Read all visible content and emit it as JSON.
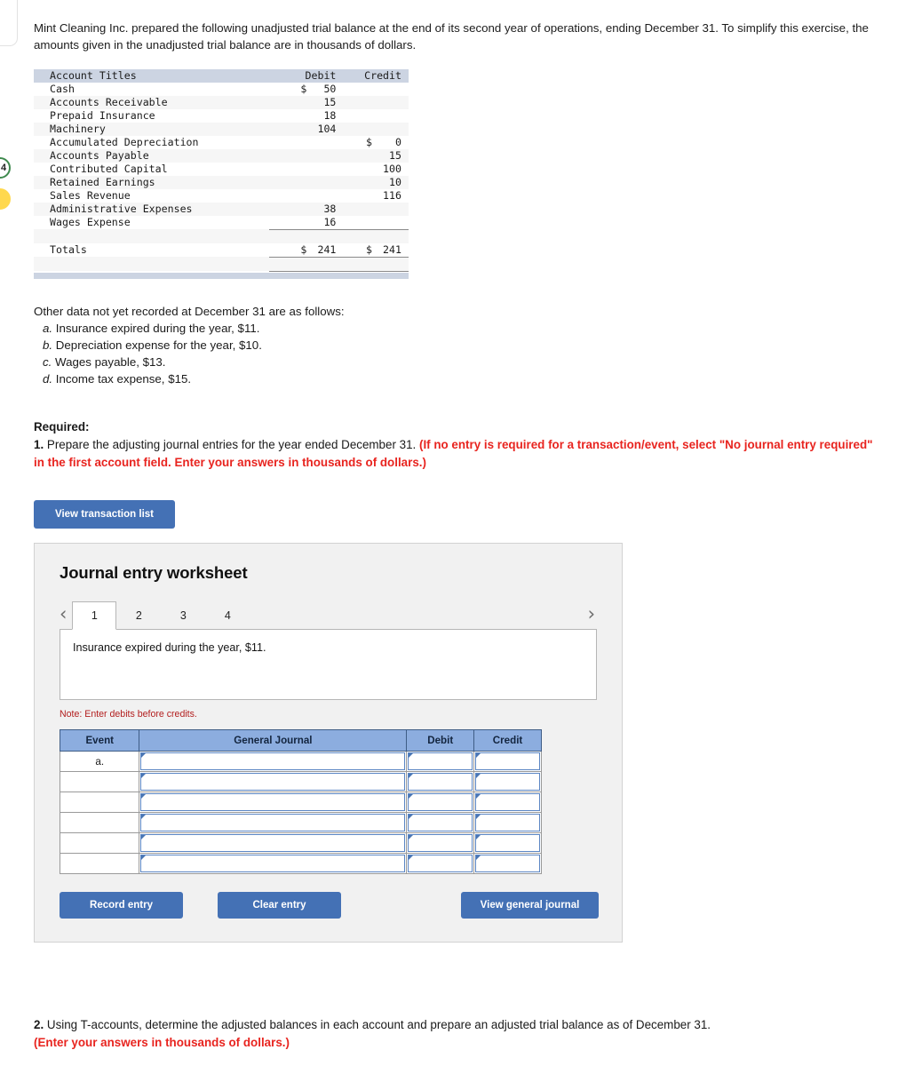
{
  "intro": {
    "paragraph": "Mint Cleaning Inc. prepared the following unadjusted trial balance at the end of its second year of operations, ending December 31. To simplify this exercise, the amounts given in the unadjusted trial balance are in thousands of dollars."
  },
  "trial_balance": {
    "headers": {
      "account": "Account Titles",
      "debit": "Debit",
      "credit": "Credit"
    },
    "rows": [
      {
        "account": "Cash",
        "debit_sym": "$",
        "debit": "50",
        "credit_sym": "",
        "credit": ""
      },
      {
        "account": "Accounts Receivable",
        "debit_sym": "",
        "debit": "15",
        "credit_sym": "",
        "credit": ""
      },
      {
        "account": "Prepaid Insurance",
        "debit_sym": "",
        "debit": "18",
        "credit_sym": "",
        "credit": ""
      },
      {
        "account": "Machinery",
        "debit_sym": "",
        "debit": "104",
        "credit_sym": "",
        "credit": ""
      },
      {
        "account": "Accumulated Depreciation",
        "debit_sym": "",
        "debit": "",
        "credit_sym": "$",
        "credit": "0"
      },
      {
        "account": "Accounts Payable",
        "debit_sym": "",
        "debit": "",
        "credit_sym": "",
        "credit": "15"
      },
      {
        "account": "Contributed Capital",
        "debit_sym": "",
        "debit": "",
        "credit_sym": "",
        "credit": "100"
      },
      {
        "account": "Retained Earnings",
        "debit_sym": "",
        "debit": "",
        "credit_sym": "",
        "credit": "10"
      },
      {
        "account": "Sales Revenue",
        "debit_sym": "",
        "debit": "",
        "credit_sym": "",
        "credit": "116"
      },
      {
        "account": "Administrative Expenses",
        "debit_sym": "",
        "debit": "38",
        "credit_sym": "",
        "credit": ""
      },
      {
        "account": "Wages Expense",
        "debit_sym": "",
        "debit": "16",
        "credit_sym": "",
        "credit": ""
      }
    ],
    "totals": {
      "label": "Totals",
      "debit_sym": "$",
      "debit": "241",
      "credit_sym": "$",
      "credit": "241"
    }
  },
  "other_data": {
    "lead": "Other data not yet recorded at December 31 are as follows:",
    "items": [
      {
        "letter": "a.",
        "text": "Insurance expired during the year, $11."
      },
      {
        "letter": "b.",
        "text": "Depreciation expense for the year, $10."
      },
      {
        "letter": "c.",
        "text": "Wages payable, $13."
      },
      {
        "letter": "d.",
        "text": "Income tax expense, $15."
      }
    ]
  },
  "required": {
    "heading": "Required:",
    "number": "1.",
    "text": " Prepare the adjusting journal entries for the year ended December 31. ",
    "red": "(If no entry is required for a transaction/event, select \"No journal entry required\" in the first account field. Enter your answers in thousands of dollars.)"
  },
  "buttons": {
    "view_transaction_list": "View transaction list",
    "record_entry": "Record entry",
    "clear_entry": "Clear entry",
    "view_general_journal": "View general journal"
  },
  "worksheet": {
    "title": "Journal entry worksheet",
    "prev_arrow": "‹",
    "next_arrow": "›",
    "tabs": [
      {
        "label": "1",
        "active": true
      },
      {
        "label": "2",
        "active": false
      },
      {
        "label": "3",
        "active": false
      },
      {
        "label": "4",
        "active": false
      }
    ],
    "tab_content": "Insurance expired during the year, $11.",
    "note": "Note: Enter debits before credits.",
    "table": {
      "headers": [
        "Event",
        "General Journal",
        "Debit",
        "Credit"
      ],
      "rows": [
        {
          "event": "a.",
          "journal": "",
          "debit": "",
          "credit": ""
        },
        {
          "event": "",
          "journal": "",
          "debit": "",
          "credit": ""
        },
        {
          "event": "",
          "journal": "",
          "debit": "",
          "credit": ""
        },
        {
          "event": "",
          "journal": "",
          "debit": "",
          "credit": ""
        },
        {
          "event": "",
          "journal": "",
          "debit": "",
          "credit": ""
        },
        {
          "event": "",
          "journal": "",
          "debit": "",
          "credit": ""
        }
      ]
    }
  },
  "closing": {
    "number": "2.",
    "text": " Using T-accounts, determine the adjusted balances in each account and prepare an adjusted trial balance as of December 31.",
    "red": "(Enter your answers in thousands of dollars.)"
  },
  "edge": {
    "badge_number": "4"
  },
  "colors": {
    "accent_blue": "#4471b5",
    "table_header_blue": "#8caddf",
    "tb_header": "#ccd4e2",
    "red": "#e8241f",
    "note_red": "#b32020",
    "green_badge": "#3f8a4e",
    "yellow_badge": "#ffd84d"
  }
}
